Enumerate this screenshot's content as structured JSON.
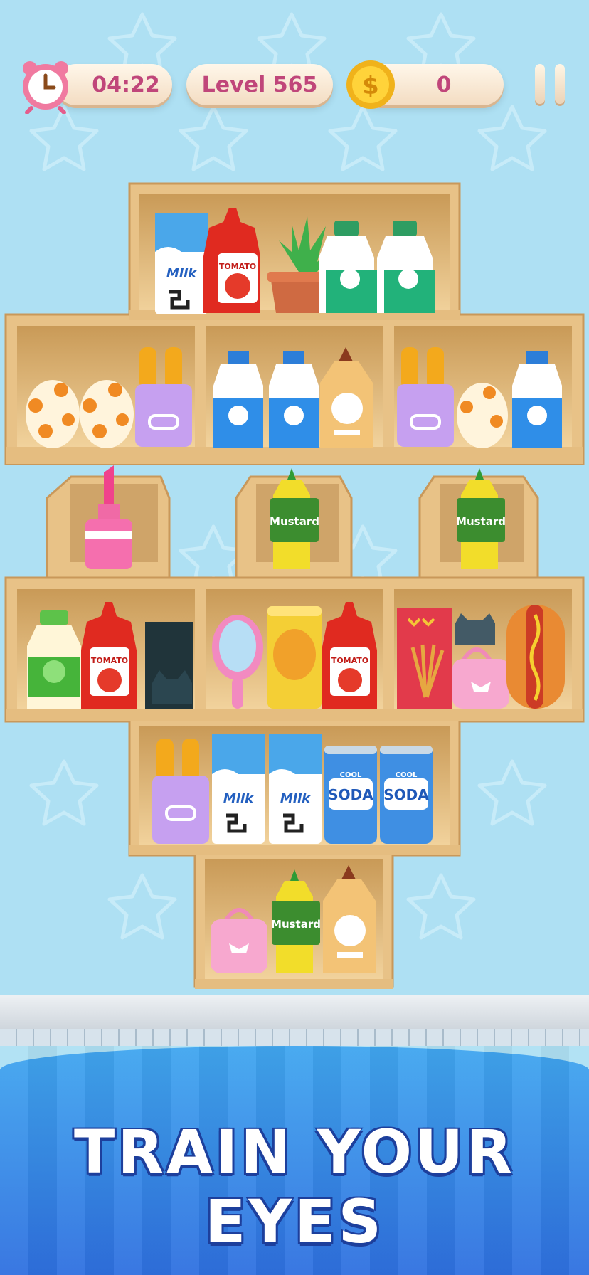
{
  "hud": {
    "timer": "04:22",
    "level": "Level 565",
    "coins": "0"
  },
  "labels": {
    "milk": "Milk",
    "tomato": "TOMATO",
    "mustard": "Mustard",
    "soda_top": "COOL",
    "soda": "SODA"
  },
  "slogan": "TRAIN YOUR EYES",
  "colors": {
    "background": "#aee0f3",
    "hud_text": "#c0467a",
    "shelf_wood": "#e2bb7d",
    "banner_top": "#40a6ef",
    "banner_bottom": "#2f70e0",
    "slogan_outline": "#1d3f9c"
  },
  "icons": [
    "alarm-clock-icon",
    "coin-icon",
    "pause-icon"
  ]
}
